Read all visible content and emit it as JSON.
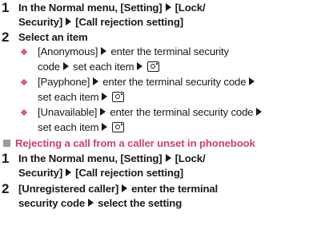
{
  "step1": {
    "number": "1",
    "line1_prefix": "In the Normal menu, [Setting]",
    "line1_suffix": "[Lock/",
    "line2_prefix": "Security]",
    "line2_suffix": "[Call rejection setting]"
  },
  "step2": {
    "number": "2",
    "text": "Select an item"
  },
  "bullets": [
    {
      "line1_a": "[Anonymous]",
      "line1_b": "enter the terminal security",
      "line2_a": "code",
      "line2_b": "set each item"
    },
    {
      "line1_a": "[Payphone]",
      "line1_b": "enter the terminal security code",
      "line2_a": "set each item"
    },
    {
      "line1_a": "[Unavailable]",
      "line1_b": "enter the terminal security code",
      "line2_a": "set each item"
    }
  ],
  "section": {
    "title": "Rejecting a call from a caller unset in phonebook"
  },
  "step3": {
    "number": "1",
    "line1_prefix": "In the Normal menu, [Setting]",
    "line1_suffix": "[Lock/",
    "line2_prefix": "Security]",
    "line2_suffix": "[Call rejection setting]"
  },
  "step4": {
    "number": "2",
    "line1_prefix": "[Unregistered caller]",
    "line1_suffix": "enter the terminal",
    "line2_prefix": "security code",
    "line2_suffix": "select the setting"
  },
  "colors": {
    "bullet": "#d85a8a",
    "section_title": "#cc3f7a",
    "section_square": "#9a9a9a",
    "text": "#1a1a1a"
  },
  "icons": {
    "arrow": "right-triangle-arrow-icon",
    "key": "camera-key-icon",
    "bullet": "diamond-bullet-icon",
    "section_marker": "square-marker-icon"
  }
}
